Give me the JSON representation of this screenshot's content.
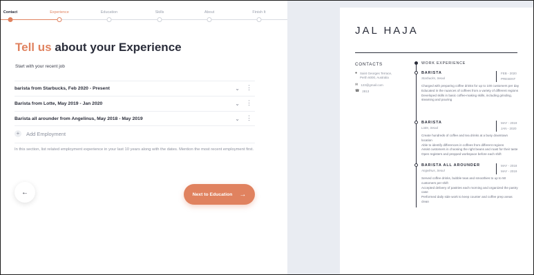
{
  "stepper": {
    "steps": [
      "Contact",
      "Experience",
      "Education",
      "Skills",
      "About",
      "Finish It"
    ]
  },
  "form": {
    "heading_accent": "Tell us",
    "heading_rest": "about your Experience",
    "subheading": "Start with your recent job",
    "jobs": [
      "barista from Starbucks, Feb 2020 - Present",
      "Barista from Lotte, May 2019 - Jan 2020",
      "Barista all arounder from Angelinus, May 2018 - May 2019"
    ],
    "add_label": "Add Employment",
    "help_text": "In this section, list related employment experience in your last 10 years along with the dates. Mention the most recent employment first.",
    "next_label": "Next to Education"
  },
  "icons": {
    "back": "arrow-left-icon",
    "next": "arrow-right-icon",
    "chevron": "chevron-down-icon",
    "more": "more-vertical-icon",
    "plus": "plus-icon",
    "location": "location-pin-icon",
    "email": "mail-icon",
    "phone": "phone-icon"
  },
  "colors": {
    "accent": "#e0825f",
    "text": "#2a2d3a",
    "preview_bg": "#e9ecf2"
  },
  "resume": {
    "name": "JAL HAJA",
    "contacts_title": "CONTACTS",
    "address_line1": "Saint Georges Terrace,",
    "address_line2": "Perth 6000, Australia",
    "email": "123@gmail.com",
    "phone": "2813",
    "work_title": "WORK EXPERIENCE",
    "entries": [
      {
        "role": "BARISTA",
        "company": "Starbucks, Seoul",
        "start": "FEB - 2020",
        "end": "PRESENT",
        "bullets": [
          "Charged with preparing coffee drinks for up to 100 customers per day",
          "Educated in the nuances of coffees from a variety of different regions",
          "Developed skills in basic coffee-making skills, including grinding, steaming and pouring"
        ]
      },
      {
        "role": "BARISTA",
        "company": "Lotte, Seoul",
        "start": "MAY - 2019",
        "end": "JAN - 2020",
        "bullets": [
          "Create hundreds of coffee and tea drinks at a busy downtown location",
          "Able to identify differences in coffees from different regions",
          "Assist customers in choosing the right beans and roast for their taste",
          "Open registers and prepped workspace before each shift"
        ]
      },
      {
        "role": "BARISTA ALL AROUNDER",
        "company": "Angelinus, Seoul",
        "start": "MAY - 2018",
        "end": "MAY - 2019",
        "bullets": [
          "Served coffee drinks, bubble teas and smoothies to up to 50 customers per shift",
          "Accepted delivery of pastries each morning and organized the pastry case",
          "Performed daily side work to keep counter and coffee prep areas clean"
        ]
      }
    ]
  }
}
